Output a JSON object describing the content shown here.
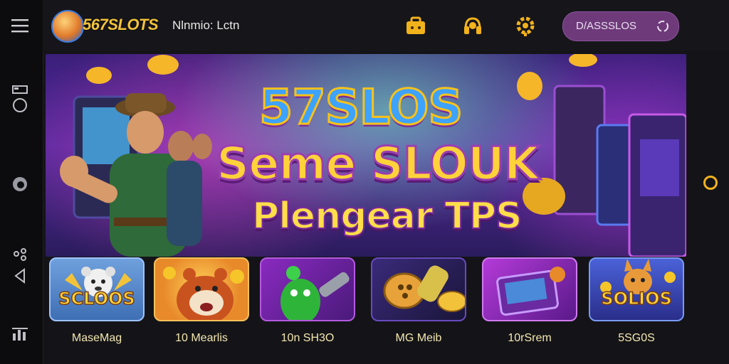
{
  "app": {
    "logo_text": "567SLOTS",
    "user_text": "Nlnmio: Lctn"
  },
  "header": {
    "account_label": "D/ASSSLOS",
    "icons": [
      "bag-icon",
      "headset-icon",
      "gear-icon"
    ]
  },
  "banner": {
    "line1": "57SLOS",
    "line2": "Seme SLOUK",
    "line3": "Plengear TPS"
  },
  "tiles": [
    {
      "label": "MaseMag",
      "art_text": "SCLOOS",
      "bg": "#4f86c7"
    },
    {
      "label": "10 Mearlis",
      "art_text": "",
      "bg": "#e8922a"
    },
    {
      "label": "10n SH3O",
      "art_text": "",
      "bg": "#7a2fa0"
    },
    {
      "label": "MG Meib",
      "art_text": "",
      "bg": "#3b2a6e"
    },
    {
      "label": "10rSrem",
      "art_text": "",
      "bg": "#8a2ab0"
    },
    {
      "label": "5SG0S",
      "art_text": "SOLIOS",
      "bg": "#3a52b8"
    }
  ],
  "colors": {
    "accent": "#f2b21c",
    "pill": "#6e3a7a",
    "bg": "#141418"
  }
}
